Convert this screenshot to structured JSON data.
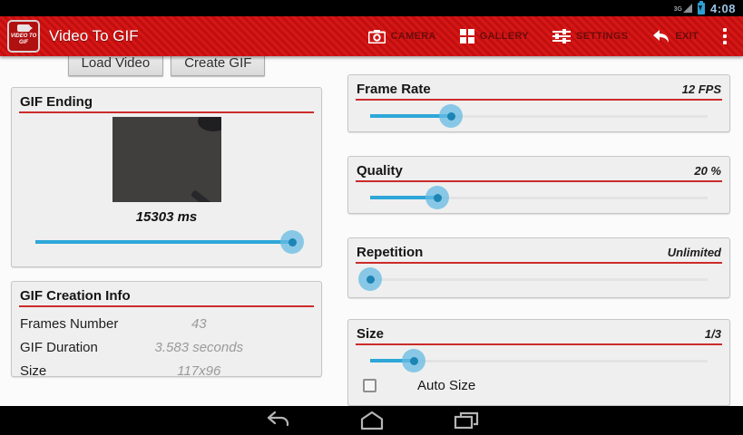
{
  "status_bar": {
    "network": "3G",
    "time": "4:08"
  },
  "action_bar": {
    "app_icon_text": "VIDEO TO GIF",
    "title": "Video To GIF",
    "camera_label": "CAMERA",
    "gallery_label": "GALLERY",
    "settings_label": "SETTINGS",
    "exit_label": "EXIT"
  },
  "toolbar": {
    "load_video": "Load Video",
    "create_gif": "Create GIF"
  },
  "gif_ending": {
    "title": "GIF Ending",
    "position_label": "15303 ms",
    "slider_percent": 98
  },
  "creation_info": {
    "title": "GIF Creation Info",
    "rows": [
      {
        "label": "Frames Number",
        "value": "43"
      },
      {
        "label": "GIF Duration",
        "value": "3.583 seconds"
      },
      {
        "label": "Size",
        "value": "117x96"
      }
    ]
  },
  "settings_panels": [
    {
      "title": "Frame Rate",
      "value": "12 FPS",
      "slider_percent": 24
    },
    {
      "title": "Quality",
      "value": "20 %",
      "slider_percent": 20
    },
    {
      "title": "Repetition",
      "value": "Unlimited",
      "slider_percent": 0
    },
    {
      "title": "Size",
      "value": "1/3",
      "slider_percent": 13,
      "checkbox_label": "Auto Size",
      "checkbox_checked": false
    }
  ],
  "colors": {
    "action_bar_red": "#c20e0e",
    "rule_red": "#cc2b2b",
    "holo_blue": "#2ea7d8",
    "status_time_blue": "#9cc3e5"
  }
}
